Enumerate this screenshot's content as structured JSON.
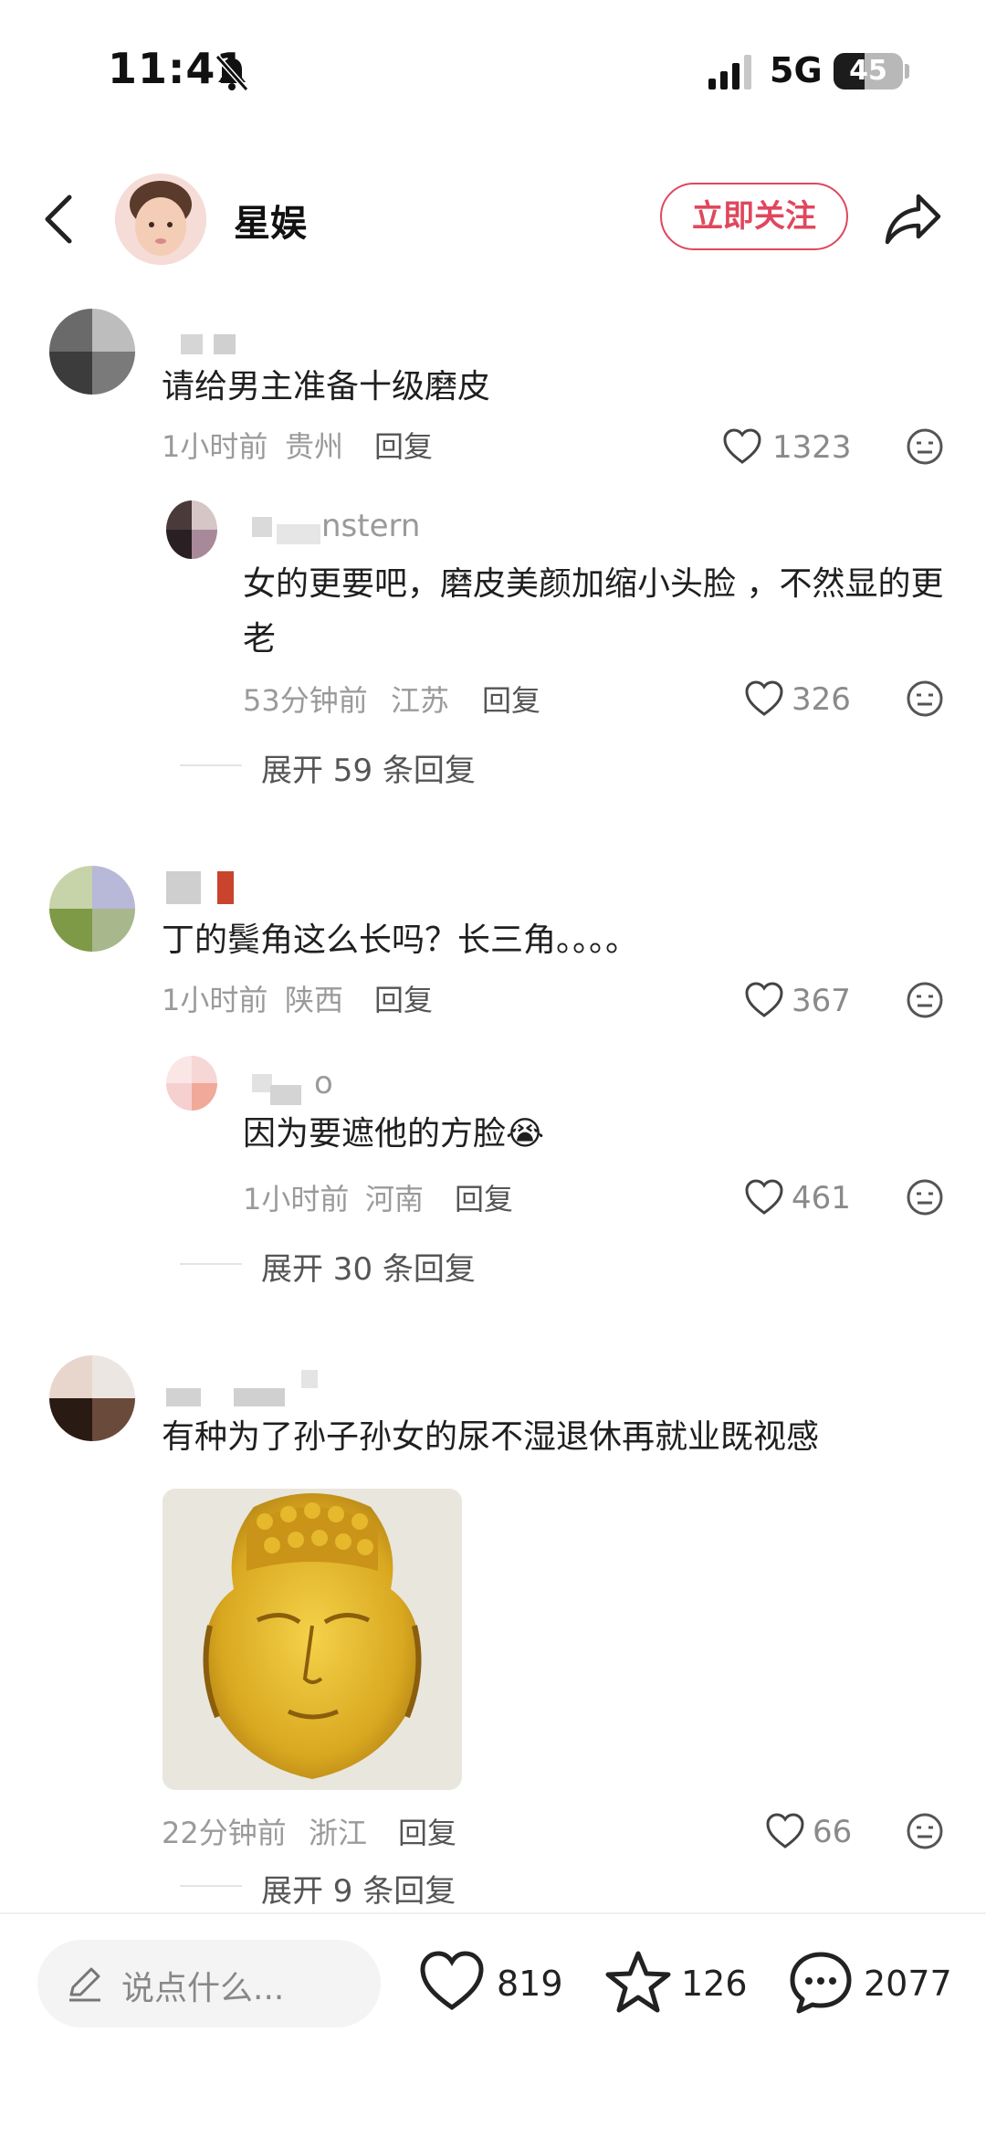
{
  "status_bar": {
    "time": "11:41",
    "network": "5G",
    "battery": "45",
    "battery_level": 0.45
  },
  "header": {
    "title": "星娱",
    "follow_label": "立即关注"
  },
  "comments": [
    {
      "user": "",
      "text": "请给男主准备十级磨皮",
      "time": "1小时前",
      "location": "贵州",
      "reply_label": "回复",
      "likes": "1323",
      "sub_reply": {
        "user": "nstern",
        "text": "女的更要吧，磨皮美颜加缩小头脸 ，不然显的更老",
        "time": "53分钟前",
        "location": "江苏",
        "reply_label": "回复",
        "likes": "326"
      },
      "expand_label": "展开 59 条回复"
    },
    {
      "user": "",
      "text": "丁的鬓角这么长吗？长三角。。。。",
      "time": "1小时前",
      "location": "陕西",
      "reply_label": "回复",
      "likes": "367",
      "sub_reply": {
        "user": "o",
        "text": "因为要遮他的方脸",
        "emoji": "😭",
        "time": "1小时前",
        "location": "河南",
        "reply_label": "回复",
        "likes": "461"
      },
      "expand_label": "展开 30 条回复"
    },
    {
      "user": "",
      "text": "有种为了孙子孙女的尿不湿退休再就业既视感",
      "time": "22分钟前",
      "location": "浙江",
      "reply_label": "回复",
      "likes": "66",
      "expand_label": "展开 9 条回复"
    }
  ],
  "bottom_bar": {
    "input_placeholder": "说点什么...",
    "likes": "819",
    "favorites": "126",
    "comments": "2077"
  },
  "colors": {
    "accent": "#e0475d",
    "meta": "#9a9a9a"
  }
}
